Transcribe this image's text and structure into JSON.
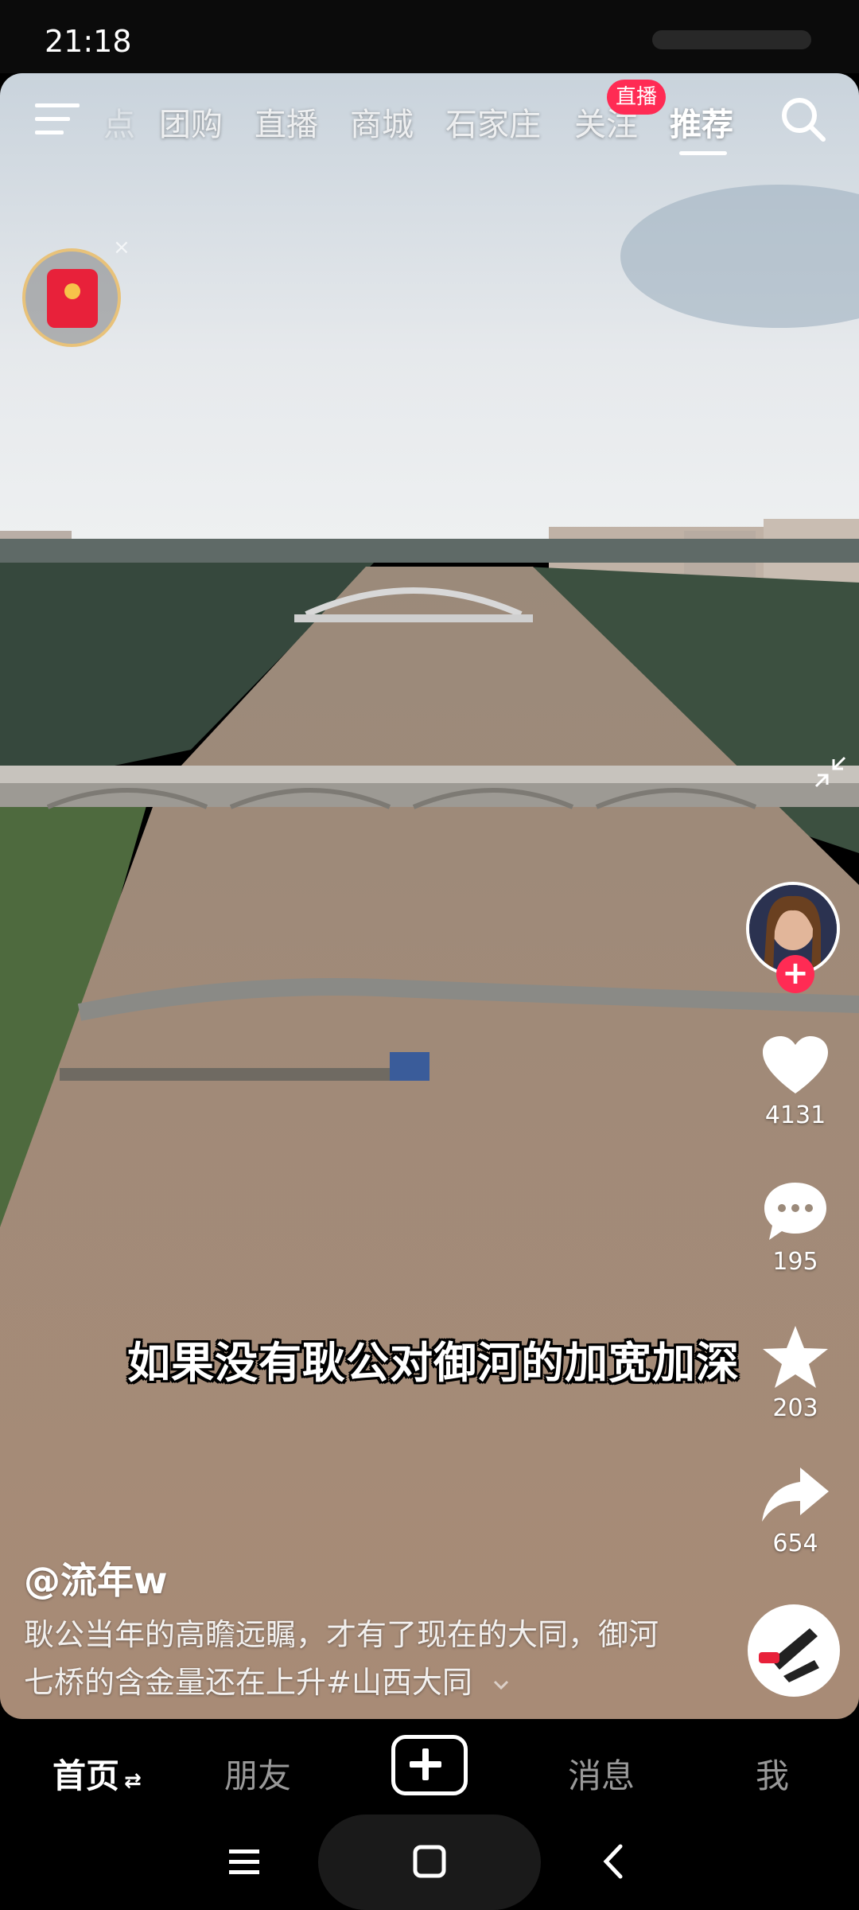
{
  "status_bar": {
    "time": "21:18"
  },
  "top_nav": {
    "items": [
      {
        "label": "点"
      },
      {
        "label": "团购"
      },
      {
        "label": "直播"
      },
      {
        "label": "商城"
      },
      {
        "label": "石家庄"
      },
      {
        "label": "关注"
      },
      {
        "label": "推荐"
      }
    ],
    "active": "推荐",
    "live_badge": "直播"
  },
  "video": {
    "subtitle": "如果没有耿公对御河的加宽加深",
    "author": "@流年w",
    "description": "耿公当年的高瞻远瞩，才有了现在的大同，御河七桥的含金量还在上升#山西大同"
  },
  "actions": {
    "likes": "4131",
    "comments": "195",
    "favorites": "203",
    "shares": "654"
  },
  "bottom_nav": {
    "home": "首页",
    "friends": "朋友",
    "messages": "消息",
    "me": "我"
  },
  "colors": {
    "accent": "#ff2b54",
    "river": "#a08672",
    "sky": "#dfe4e8"
  },
  "icons": [
    "menu-icon",
    "search-icon",
    "red-packet-icon",
    "collapse-icon",
    "heart-icon",
    "comment-icon",
    "star-icon",
    "share-icon",
    "music-disc-icon",
    "create-icon",
    "recent-apps-icon",
    "home-icon",
    "back-icon"
  ]
}
